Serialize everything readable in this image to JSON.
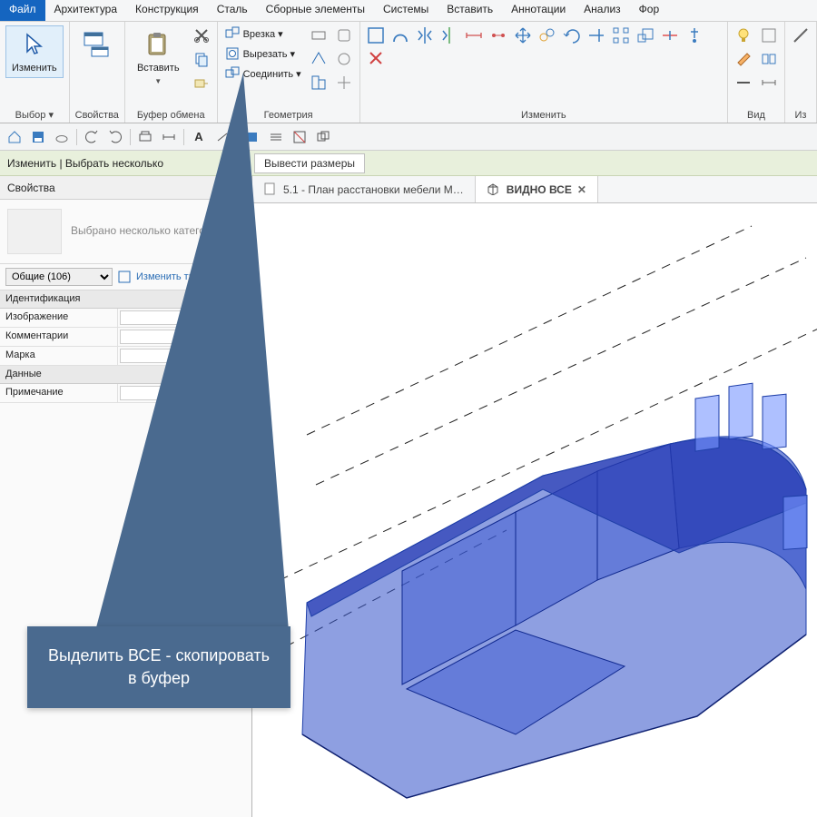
{
  "menu": {
    "items": [
      "Файл",
      "Архитектура",
      "Конструкция",
      "Сталь",
      "Сборные элементы",
      "Системы",
      "Вставить",
      "Аннотации",
      "Анализ",
      "Фор"
    ]
  },
  "ribbon": {
    "groups": {
      "select": {
        "label": "Выбор ▾",
        "modify": "Изменить"
      },
      "props": {
        "label": "Свойства"
      },
      "clip": {
        "label": "Буфер обмена",
        "paste": "Вставить"
      },
      "geom": {
        "label": "Геометрия",
        "cut_label": "Врезка ▾",
        "cutout_label": "Вырезать ▾",
        "join_label": "Соединить ▾"
      },
      "modify": {
        "label": "Изменить"
      },
      "view": {
        "label": "Вид"
      },
      "meas": {
        "label": "Из"
      }
    }
  },
  "context": {
    "left": "Изменить | Выбрать несколько",
    "right": "Вывести размеры"
  },
  "properties": {
    "title": "Свойства",
    "preview_text": "Выбрано несколько категорий",
    "filter": "Общие (106)",
    "edit_type": "Изменить тип",
    "sections": {
      "ident": "Идентификация",
      "rows_ident": [
        {
          "k": "Изображение",
          "v": ""
        },
        {
          "k": "Комментарии",
          "v": ""
        },
        {
          "k": "Марка",
          "v": ""
        }
      ],
      "data": "Данные",
      "rows_data": [
        {
          "k": "Примечание",
          "v": ""
        }
      ]
    }
  },
  "tabs": {
    "inactive": "5.1 - План расстановки мебели М…",
    "active": "ВИДНО ВСЕ"
  },
  "callout": "Выделить ВСЕ - скопировать в буфер"
}
